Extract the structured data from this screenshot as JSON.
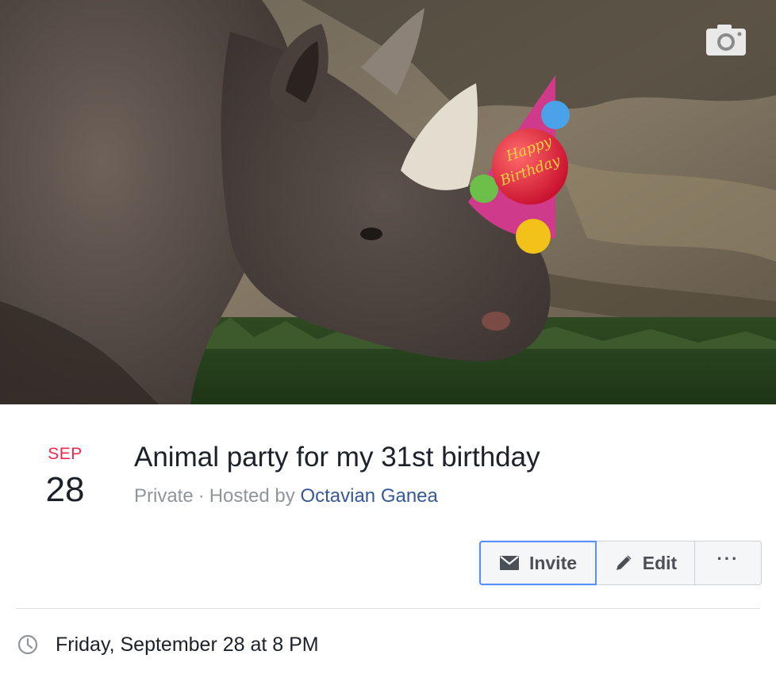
{
  "cover": {
    "alt": "Rhinoceros wearing a Happy Birthday party hat",
    "hat_text_line1": "Happy",
    "hat_text_line2": "Birthday",
    "camera_icon": "camera-icon"
  },
  "event": {
    "month": "SEP",
    "day": "28",
    "title": "Animal party for my 31st birthday",
    "privacy": "Private",
    "separator": "·",
    "hosted_by_prefix": "Hosted by",
    "host_name": "Octavian Ganea"
  },
  "actions": {
    "invite_label": "Invite",
    "invite_icon": "envelope-icon",
    "edit_label": "Edit",
    "edit_icon": "pencil-icon",
    "more_label": "···"
  },
  "details": {
    "time_icon": "clock-icon",
    "time_text": "Friday, September 28 at 8 PM"
  },
  "colors": {
    "accent_blue": "#5890ff",
    "link_blue": "#365899",
    "date_red": "#f02849",
    "muted_text": "#90949c"
  }
}
